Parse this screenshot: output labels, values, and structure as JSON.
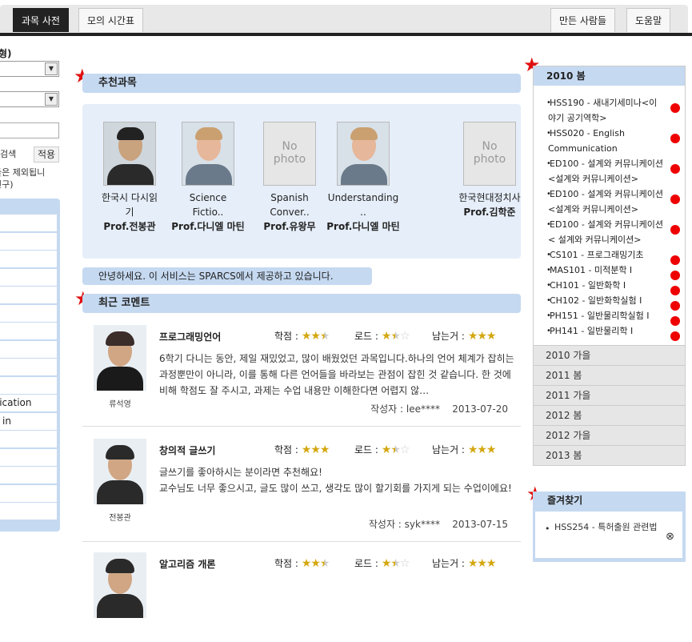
{
  "tabs": {
    "dictionary": "과목 사전",
    "timetable": "모의 시간표",
    "makers": "만든 사람들",
    "help": "도움말"
  },
  "left": {
    "title_fragment": "형)",
    "search_label": "검색",
    "apply_label": "적용",
    "note_line1": "들은 제외됩니",
    "note_line2": "연구)",
    "rows": [
      "",
      "",
      "",
      "",
      "",
      "",
      "",
      "",
      "",
      "",
      "unication",
      "ng in",
      "",
      "",
      "",
      "",
      ""
    ]
  },
  "recommend": {
    "title": "추천과목",
    "professors": [
      {
        "course_line1": "한국시 다시읽",
        "course_line2": "기",
        "name": "Prof.전봉관",
        "photo": "man-suit"
      },
      {
        "course_line1": "Science",
        "course_line2": "Fictio..",
        "name": "Prof.다니엘 마틴",
        "photo": "man-light"
      },
      {
        "course_line1": "Spanish",
        "course_line2": "Conver..",
        "name": "Prof.유왕무",
        "photo": "none"
      },
      {
        "course_line1": "Understanding",
        "course_line2": "..",
        "name": "Prof.다니엘 마틴",
        "photo": "man-light"
      },
      {
        "course_line1": "한국현대정치사",
        "course_line2": "",
        "name": "Prof.김학준",
        "photo": "none"
      }
    ],
    "no_photo_line1": "No",
    "no_photo_line2": "photo"
  },
  "notice": "안녕하세요. 이 서비스는 SPARCS에서 제공하고 있습니다.",
  "comments_title": "최근 코멘트",
  "rating_labels": {
    "grade": "학점 :",
    "load": "로드 :",
    "gain": "남는거 :"
  },
  "comments": [
    {
      "course": "프로그래밍언어",
      "prof": "류석영",
      "grade": 2.5,
      "load": 1.5,
      "gain": 3,
      "body": "6학기 다니는 동안, 제일 재밌었고, 많이 배웠었던 과목입니다.하나의 언어 체계가 잡히는 과정뿐만이 아니라, 이를 통해 다른 언어들을 바라보는 관점이 잡힌 것 같습니다. 한 것에 비해 학점도 잘 주시고, 과제는 수업 내용만 이해한다면 어렵지 않…",
      "author": "작성자 : lee****",
      "date": "2013-07-20"
    },
    {
      "course": "창의적 글쓰기",
      "prof": "전봉관",
      "grade": 3,
      "load": 1.5,
      "gain": 3,
      "body": "글쓰기를 좋아하시는 분이라면 추천해요!\n교수님도 너무 좋으시고, 글도 많이 쓰고, 생각도 많이 할기회를 가지게 되는 수업이에요!",
      "author": "작성자 : syk****",
      "date": "2013-07-15"
    },
    {
      "course": "알고리즘 개론",
      "prof": "",
      "grade": 2.5,
      "load": 1.5,
      "gain": 3,
      "body": "",
      "author": "",
      "date": ""
    }
  ],
  "semester": {
    "current": "2010 봄",
    "courses": [
      "HSS190 - 새내기세미나<이야기 공기역학>",
      "HSS020 - English Communication",
      "ED100 - 설계와 커뮤니케이션<설계와 커뮤니케이션>",
      "ED100 - 설계와 커뮤니케이션<설계와 커뮤니케이션>",
      "ED100 - 설계와 커뮤니케이션 < 설계와 커뮤니케이션>",
      "CS101 - 프로그래밍기초",
      "MAS101 - 미적분학 I",
      "CH101 - 일반화학 I",
      "CH102 - 일반화학실험 I",
      "PH151 - 일반물리학실험 I",
      "PH141 - 일반물리학 I"
    ],
    "others": [
      "2010 가을",
      "2011 봄",
      "2011 가을",
      "2012 봄",
      "2012 가을",
      "2013 봄"
    ]
  },
  "favorites": {
    "title": "즐겨찾기",
    "items": [
      "HSS254 - 특허출원 관련법"
    ]
  },
  "colors": {
    "accent_bar": "#c5d9f1",
    "star_gold": "#d4a70f",
    "remove_dot": "#e00000",
    "tab_active": "#222222"
  }
}
